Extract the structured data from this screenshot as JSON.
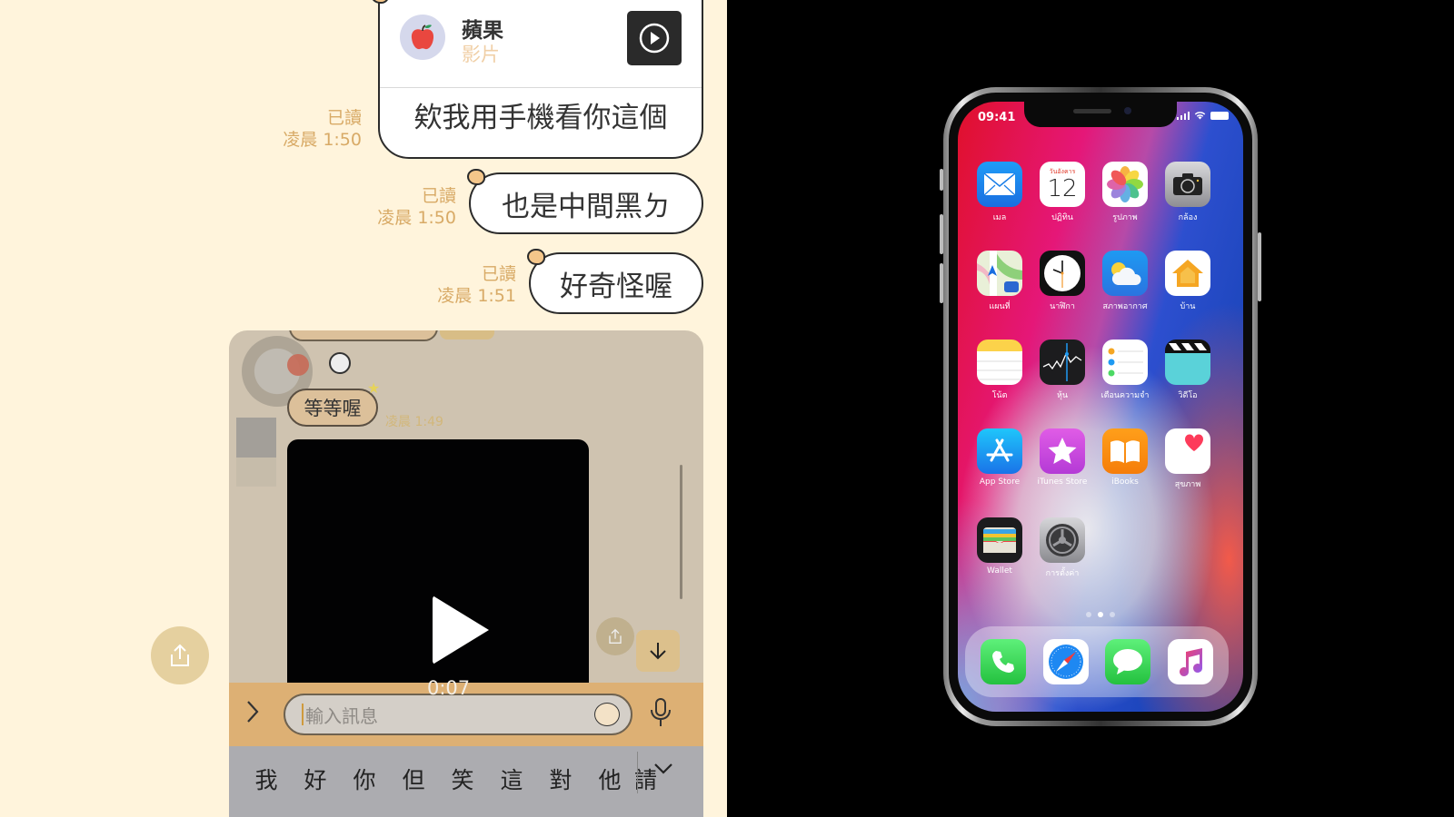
{
  "chat": {
    "shared_card": {
      "title": "蘋果",
      "subtitle": "影片",
      "message": "欸我用手機看你這個",
      "icons": {
        "avatar": "apple-avatar-icon",
        "thumb": "video-thumbnail-play-icon"
      }
    },
    "messages": [
      {
        "text": "欸我用手機看你這個",
        "read": "已讀",
        "time": "凌晨 1:50"
      },
      {
        "text": "也是中間黑ㄉ",
        "read": "已讀",
        "time": "凌晨 1:50"
      },
      {
        "text": "好奇怪喔",
        "read": "已讀",
        "time": "凌晨 1:51"
      }
    ],
    "share_button_icon": "share-icon"
  },
  "overlay": {
    "bubble_text": "等等喔",
    "bubble_time": "凌晨 1:49",
    "video_duration": "0:07",
    "input_placeholder": "輸入訊息",
    "candidates": [
      "我",
      "好",
      "你",
      "但",
      "笑",
      "這",
      "對",
      "他",
      "請"
    ],
    "icons": {
      "expand": "chevron-right-icon",
      "sticker": "sticker-icon",
      "mic": "microphone-icon",
      "collapse": "chevron-down-icon",
      "scroll_down": "arrow-down-icon",
      "share": "share-icon",
      "play": "play-icon"
    }
  },
  "phone": {
    "status": {
      "time": "09:41",
      "icons": [
        "signal-icon",
        "wifi-icon",
        "battery-icon"
      ]
    },
    "apps": [
      {
        "label": "เมล",
        "icon": "mail-icon"
      },
      {
        "label": "ปฏิทิน",
        "icon": "calendar-icon",
        "day_name": "วันอังคาร",
        "day": "12"
      },
      {
        "label": "รูปภาพ",
        "icon": "photos-icon"
      },
      {
        "label": "กล้อง",
        "icon": "camera-icon"
      },
      {
        "label": "แผนที่",
        "icon": "maps-icon"
      },
      {
        "label": "นาฬิกา",
        "icon": "clock-icon"
      },
      {
        "label": "สภาพอากาศ",
        "icon": "weather-icon"
      },
      {
        "label": "บ้าน",
        "icon": "home-icon"
      },
      {
        "label": "โน้ต",
        "icon": "notes-icon"
      },
      {
        "label": "หุ้น",
        "icon": "stocks-icon"
      },
      {
        "label": "เตือนความจำ",
        "icon": "reminders-icon"
      },
      {
        "label": "วิดีโอ",
        "icon": "videos-icon"
      },
      {
        "label": "App Store",
        "icon": "app-store-icon"
      },
      {
        "label": "iTunes Store",
        "icon": "itunes-store-icon"
      },
      {
        "label": "iBooks",
        "icon": "ibooks-icon"
      },
      {
        "label": "สุขภาพ",
        "icon": "health-icon"
      },
      {
        "label": "Wallet",
        "icon": "wallet-icon"
      },
      {
        "label": "การตั้งค่า",
        "icon": "settings-icon"
      }
    ],
    "page_dots": {
      "count": 3,
      "active": 2
    },
    "dock": [
      {
        "name": "Phone",
        "icon": "phone-icon"
      },
      {
        "name": "Safari",
        "icon": "safari-icon"
      },
      {
        "name": "Messages",
        "icon": "messages-icon"
      },
      {
        "name": "Music",
        "icon": "music-icon"
      }
    ]
  }
}
